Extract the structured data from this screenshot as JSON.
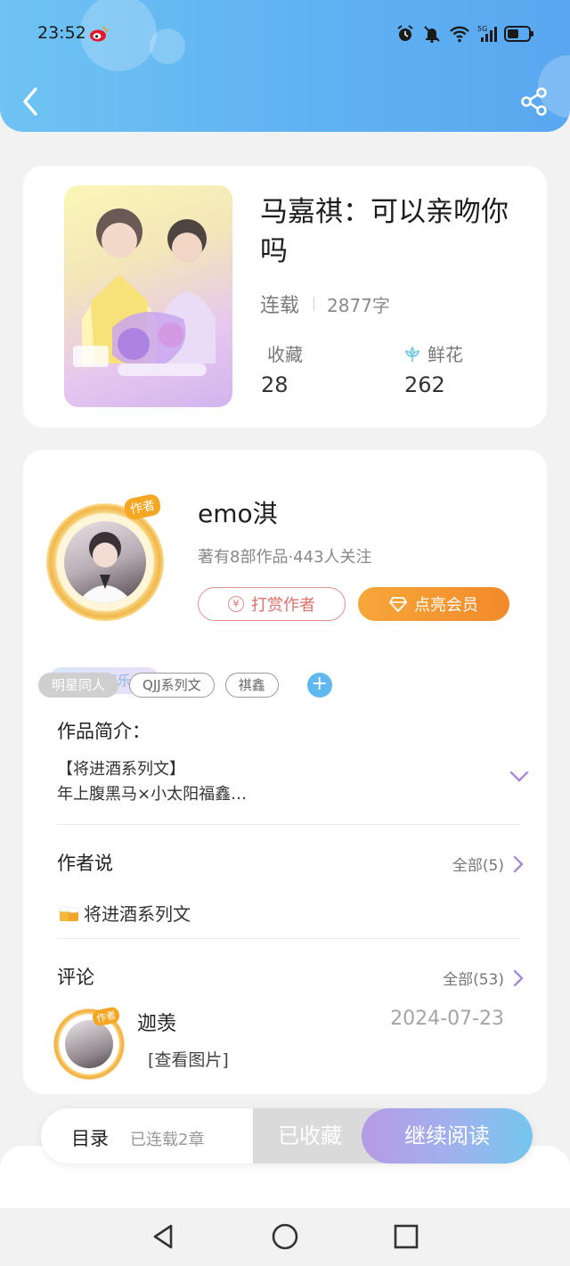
{
  "status_bar": {
    "time": "23:52",
    "network": "5G"
  },
  "book": {
    "title": "马嘉祺：可以亲吻你吗",
    "status": "连载",
    "word_count": "2877字",
    "favorites_label": "收藏",
    "favorites_count": "28",
    "flowers_label": "鲜花",
    "flowers_count": "262"
  },
  "author": {
    "name": "emo淇",
    "avatar_tag": "作者",
    "mood": "平安喜乐",
    "meta": "著有8部作品·443人关注",
    "tip_label": "打赏作者",
    "tip_icon": "¥",
    "vip_label": "点亮会员"
  },
  "tags": [
    "明星同人",
    "QJJ系列文",
    "祺鑫"
  ],
  "intro": {
    "title": "作品简介：",
    "line1": "【将进酒系列文】",
    "line2": "年上腹黑马×小太阳福鑫…"
  },
  "author_say": {
    "title": "作者说",
    "more": "全部(5)",
    "item": "将进酒系列文"
  },
  "comments": {
    "title": "评论",
    "more": "全部(53)",
    "user": "迦羡",
    "avatar_tag": "作者",
    "date": "2024-07-23",
    "text": "[查看图片]"
  },
  "action_bar": {
    "toc": "目录",
    "toc_status": "已连载2章",
    "collected": "已收藏",
    "continue": "继续阅读"
  },
  "colors": {
    "header_start": "#6ec3f3",
    "header_end": "#5aa7f0",
    "vip": "#f28a2a",
    "tip": "#e06e6a",
    "accent_blue": "#5fb8f0"
  }
}
